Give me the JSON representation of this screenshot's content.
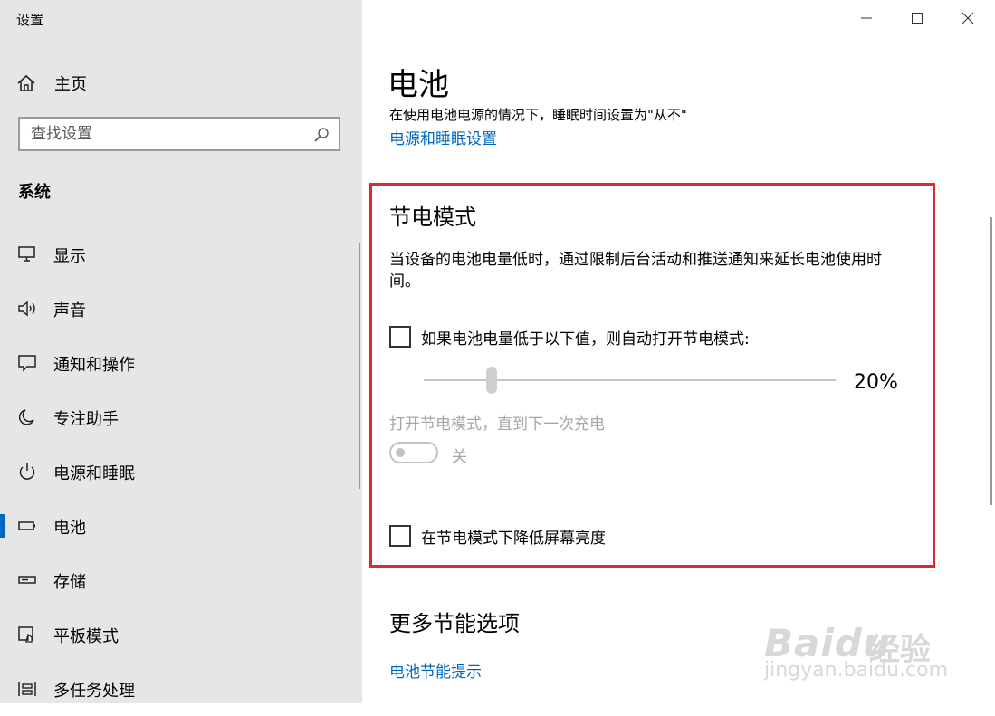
{
  "window": {
    "title": "设置",
    "controls": {
      "minimize": "minimize-icon",
      "maximize": "maximize-icon",
      "close": "close-icon"
    }
  },
  "sidebar": {
    "home_label": "主页",
    "search_placeholder": "查找设置",
    "section_title": "系统",
    "items": [
      {
        "label": "显示",
        "icon": "display-icon"
      },
      {
        "label": "声音",
        "icon": "sound-icon"
      },
      {
        "label": "通知和操作",
        "icon": "notification-icon"
      },
      {
        "label": "专注助手",
        "icon": "moon-icon"
      },
      {
        "label": "电源和睡眠",
        "icon": "power-icon"
      },
      {
        "label": "电池",
        "icon": "battery-icon",
        "active": true
      },
      {
        "label": "存储",
        "icon": "storage-icon"
      },
      {
        "label": "平板模式",
        "icon": "tablet-mode-icon"
      },
      {
        "label": "多任务处理",
        "icon": "multitasking-icon"
      }
    ]
  },
  "main": {
    "title": "电池",
    "sleep_note": "在使用电池电源的情况下，睡眠时间设置为\"从不\"",
    "power_sleep_link": "电源和睡眠设置",
    "battery_saver": {
      "title": "节电模式",
      "description": "当设备的电池电量低时，通过限制后台活动和推送通知来延长电池使用时间。",
      "auto_on_label": "如果电池电量低于以下值，则自动打开节电模式:",
      "auto_on_checked": false,
      "threshold_value": "20%",
      "threshold_percent": 20,
      "status_label": "打开节电模式，直到下一次充电",
      "toggle_state": "关",
      "toggle_on": false,
      "lower_brightness_label": "在节电模式下降低屏幕亮度",
      "lower_brightness_checked": false
    },
    "more_options": {
      "title": "更多节能选项",
      "tips_link": "电池节能提示"
    }
  },
  "watermark": {
    "brand": "Baidu",
    "suffix": "经验",
    "url": "jingyan.baidu.com"
  },
  "colors": {
    "accent": "#0067c0",
    "highlight": "#e0282e",
    "sidebar_bg": "#e6e6e6"
  }
}
